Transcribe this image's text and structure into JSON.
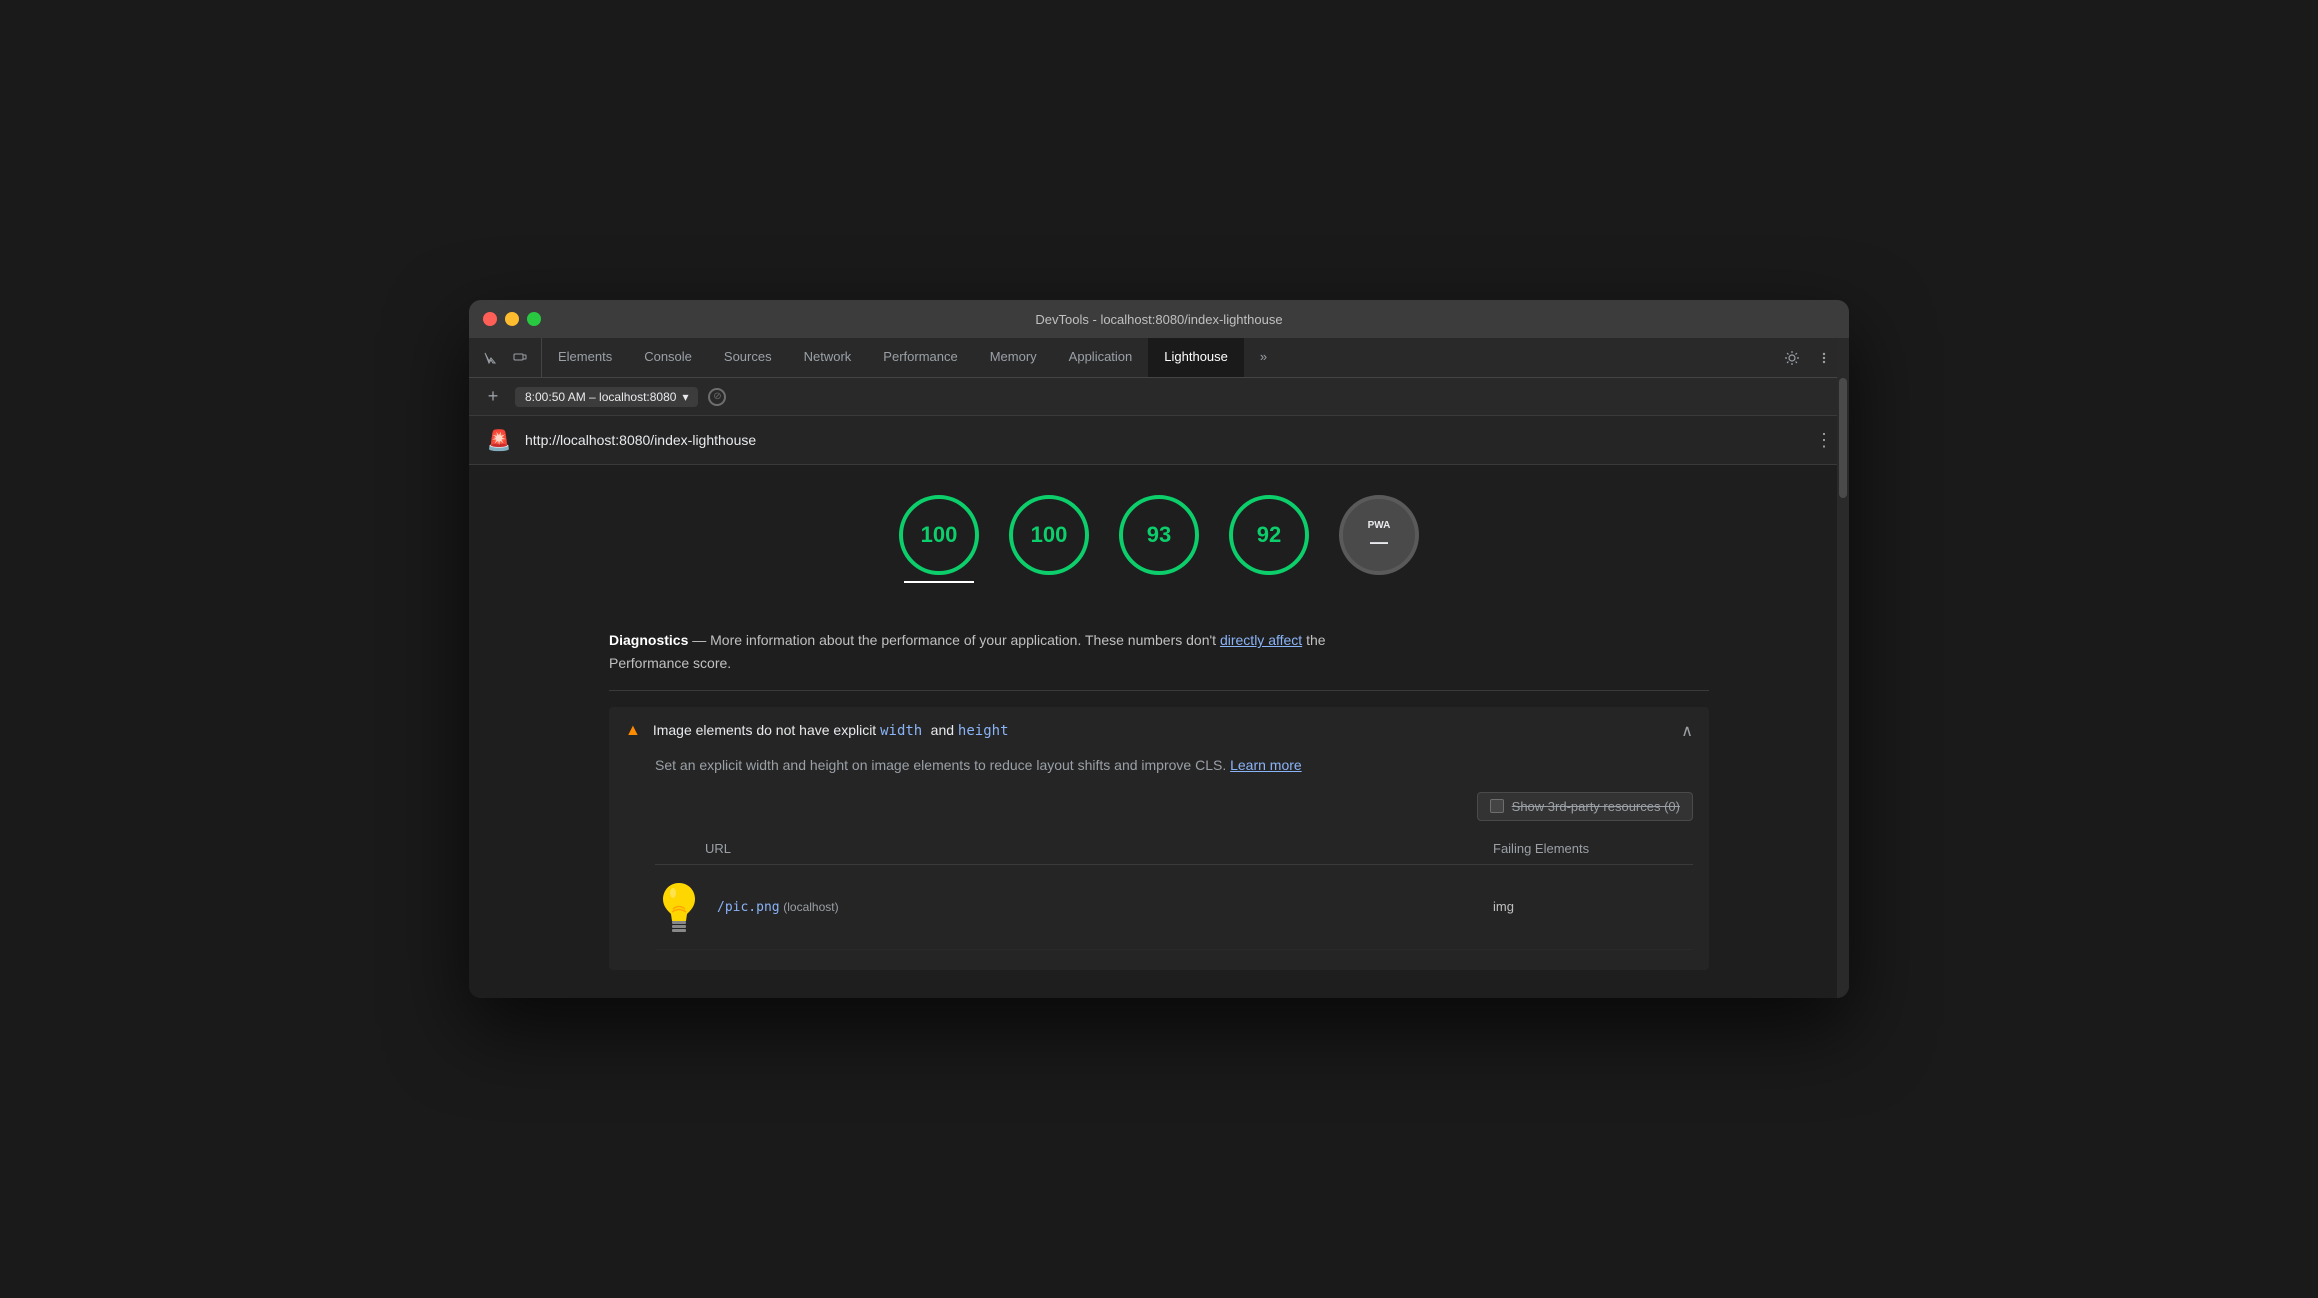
{
  "titleBar": {
    "title": "DevTools - localhost:8080/index-lighthouse"
  },
  "tabs": [
    {
      "id": "elements",
      "label": "Elements",
      "active": false
    },
    {
      "id": "console",
      "label": "Console",
      "active": false
    },
    {
      "id": "sources",
      "label": "Sources",
      "active": false
    },
    {
      "id": "network",
      "label": "Network",
      "active": false
    },
    {
      "id": "performance",
      "label": "Performance",
      "active": false
    },
    {
      "id": "memory",
      "label": "Memory",
      "active": false
    },
    {
      "id": "application",
      "label": "Application",
      "active": false
    },
    {
      "id": "lighthouse",
      "label": "Lighthouse",
      "active": true
    }
  ],
  "addressBar": {
    "urlText": "8:00:50 AM – localhost:8080",
    "dropdownArrow": "▾"
  },
  "lighthouseBar": {
    "url": "http://localhost:8080/index-lighthouse"
  },
  "scores": [
    {
      "id": "perf",
      "value": "100",
      "type": "green",
      "underline": true
    },
    {
      "id": "acc",
      "value": "100",
      "type": "green",
      "underline": false
    },
    {
      "id": "bp",
      "value": "93",
      "type": "green",
      "underline": false
    },
    {
      "id": "seo",
      "value": "92",
      "type": "green",
      "underline": false
    },
    {
      "id": "pwa",
      "value": "PWA\n—",
      "type": "gray",
      "underline": false
    }
  ],
  "diagnostics": {
    "title": "Diagnostics",
    "description": "— More information about the performance of your application. These numbers don't",
    "linkText": "directly affect",
    "descriptionSuffix": "the\nPerformance score."
  },
  "issue": {
    "title_prefix": "Image elements do not have explicit",
    "code1": "width",
    "title_and": "and",
    "code2": "height",
    "description": "Set an explicit width and height on image elements to reduce layout shifts and improve CLS.",
    "learnMoreText": "Learn more",
    "thirdPartyLabel": "Show 3rd-party resources (0)",
    "tableHeaders": {
      "url": "URL",
      "failingElements": "Failing Elements"
    },
    "tableRows": [
      {
        "thumbnail": "💡",
        "urlLink": "/pic.png",
        "urlHost": "(localhost)",
        "failingElement": "img"
      }
    ]
  }
}
